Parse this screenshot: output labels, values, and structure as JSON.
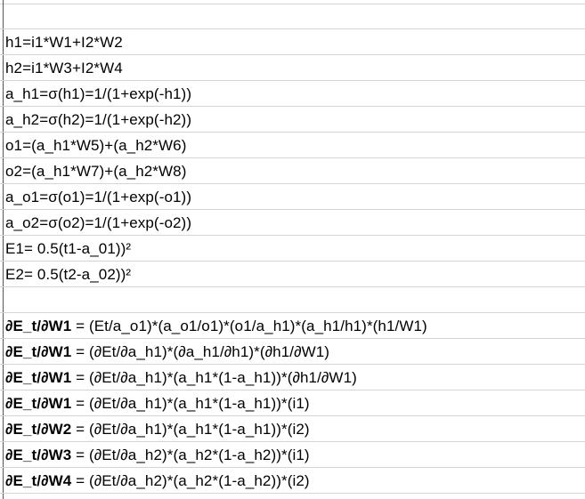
{
  "sheet": {
    "empty_rows": [
      "",
      ""
    ],
    "formulas": [
      "h1=i1*W1+I2*W2",
      "h2=i1*W3+I2*W4",
      "a_h1=σ(h1)=1/(1+exp(-h1))",
      "a_h2=σ(h2)=1/(1+exp(-h2))",
      "o1=(a_h1*W5)+(a_h2*W6)",
      "o2=(a_h1*W7)+(a_h2*W8)",
      "a_o1=σ(o1)=1/(1+exp(-o1))",
      "a_o2=σ(o2)=1/(1+exp(-o2))",
      "E1= 0.5(t1-a_01))²",
      "E2= 0.5(t2-a_02))²"
    ],
    "derivatives": [
      {
        "lhs": "∂E_t/∂W1",
        "rhs": " = (Et/a_o1)*(a_o1/o1)*(o1/a_h1)*(a_h1/h1)*(h1/W1)"
      },
      {
        "lhs": "∂E_t/∂W1",
        "rhs": " =  (∂Et/∂a_h1)*(∂a_h1/∂h1)*(∂h1/∂W1)"
      },
      {
        "lhs": "∂E_t/∂W1",
        "rhs": " = (∂Et/∂a_h1)*(a_h1*(1-a_h1))*(∂h1/∂W1)"
      },
      {
        "lhs": "∂E_t/∂W1",
        "rhs": " = (∂Et/∂a_h1)*(a_h1*(1-a_h1))*(i1)"
      },
      {
        "lhs": "∂E_t/∂W2",
        "rhs": " = (∂Et/∂a_h1)*(a_h1*(1-a_h1))*(i2)"
      },
      {
        "lhs": "∂E_t/∂W3",
        "rhs": " = (∂Et/∂a_h2)*(a_h2*(1-a_h2))*(i1)"
      },
      {
        "lhs": "∂E_t/∂W4",
        "rhs": " = (∂Et/∂a_h2)*(a_h2*(1-a_h2))*(i2)"
      }
    ]
  }
}
